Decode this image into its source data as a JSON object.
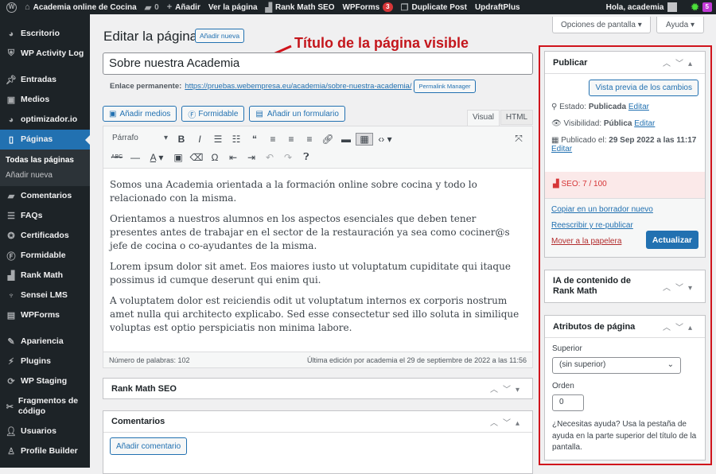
{
  "adminbar": {
    "site": "Academia online de Cocina",
    "comments": "0",
    "add": "Añadir",
    "view": "Ver la página",
    "rankmath": "Rank Math SEO",
    "wpforms": "WPForms",
    "wpforms_count": "3",
    "duplicate": "Duplicate Post",
    "updraft": "UpdraftPlus",
    "greeting": "Hola, academia",
    "debug_count": "5"
  },
  "sidebar": {
    "items": [
      {
        "label": "Escritorio",
        "icon": "dashboard-icon"
      },
      {
        "label": "WP Activity Log",
        "icon": "shield-icon"
      },
      {
        "label": "Entradas",
        "icon": "pin-icon"
      },
      {
        "label": "Medios",
        "icon": "media-icon"
      },
      {
        "label": "optimizador.io",
        "icon": "gauge-icon"
      },
      {
        "label": "Páginas",
        "icon": "pages-icon"
      },
      {
        "label": "Comentarios",
        "icon": "comment-icon"
      },
      {
        "label": "FAQs",
        "icon": "list-icon"
      },
      {
        "label": "Certificados",
        "icon": "certificate-icon"
      },
      {
        "label": "Formidable",
        "icon": "formidable-icon"
      },
      {
        "label": "Rank Math",
        "icon": "rankmath-icon"
      },
      {
        "label": "Sensei LMS",
        "icon": "sensei-icon"
      },
      {
        "label": "WPForms",
        "icon": "wpforms-icon"
      },
      {
        "label": "Apariencia",
        "icon": "brush-icon"
      },
      {
        "label": "Plugins",
        "icon": "plugin-icon"
      },
      {
        "label": "WP Staging",
        "icon": "sync-icon"
      },
      {
        "label": "Fragmentos de código",
        "icon": "scissors-icon"
      },
      {
        "label": "Usuarios",
        "icon": "user-icon"
      },
      {
        "label": "Profile Builder",
        "icon": "profile-icon"
      }
    ],
    "submenu": [
      "Todas las páginas",
      "Añadir nueva"
    ]
  },
  "header": {
    "title": "Editar la página",
    "add_new": "Añadir nueva",
    "annotation": "Título de la página visible"
  },
  "post": {
    "title": "Sobre nuestra Academia",
    "permalink_label": "Enlace permanente:",
    "permalink": "https://pruebas.webempresa.eu/academia/sobre-nuestra-academia/",
    "permalink_manager": "Permalink Manager"
  },
  "editor": {
    "add_media": "Añadir medios",
    "formidable": "Formidable",
    "add_form": "Añadir un formulario",
    "tab_visual": "Visual",
    "tab_html": "HTML",
    "format": "Párrafo",
    "paragraphs": [
      "Somos una Academia orientada a la formación online sobre cocina y todo lo relacionado con la misma.",
      "Orientamos a nuestros alumnos en los aspectos esenciales que deben tener presentes antes de trabajar en el sector de la restauración ya sea como cociner@s jefe de cocina o co-ayudantes de la misma.",
      "Lorem ipsum dolor sit amet. Eos maiores iusto ut voluptatum cupiditate qui itaque possimus id cumque deserunt qui enim qui.",
      "A voluptatem dolor est reiciendis odit ut voluptatum internos ex corporis nostrum amet nulla qui architecto explicabo. Sed esse consectetur sed illo soluta in similique voluptas est optio perspiciatis non minima labore."
    ],
    "word_count": "Número de palabras: 102",
    "last_edit": "Última edición por academia el 29 de septiembre de 2022 a las 11:56"
  },
  "boxes": {
    "rankmath": "Rank Math SEO",
    "comments": "Comentarios",
    "add_comment": "Añadir comentario"
  },
  "screen": {
    "options": "Opciones de pantalla ▾",
    "help": "Ayuda ▾"
  },
  "publish": {
    "title": "Publicar",
    "preview": "Vista previa de los cambios",
    "status_label": "Estado:",
    "status": "Publicada",
    "visibility_label": "Visibilidad:",
    "visibility": "Pública",
    "published_label": "Publicado el:",
    "published": "29 Sep 2022 a las 11:17",
    "edit": "Editar",
    "seo": "SEO: 7 / 100",
    "copy": "Copiar en un borrador nuevo",
    "rewrite": "Reescribir y re-publicar",
    "trash": "Mover a la papelera",
    "update": "Actualizar"
  },
  "ai_box": {
    "title": "IA de contenido de Rank Math"
  },
  "attributes": {
    "title": "Atributos de página",
    "parent_label": "Superior",
    "parent": "(sin superior)",
    "order_label": "Orden",
    "order": "0",
    "help": "¿Necesitas ayuda? Usa la pestaña de ayuda en la parte superior del título de la pantalla."
  }
}
